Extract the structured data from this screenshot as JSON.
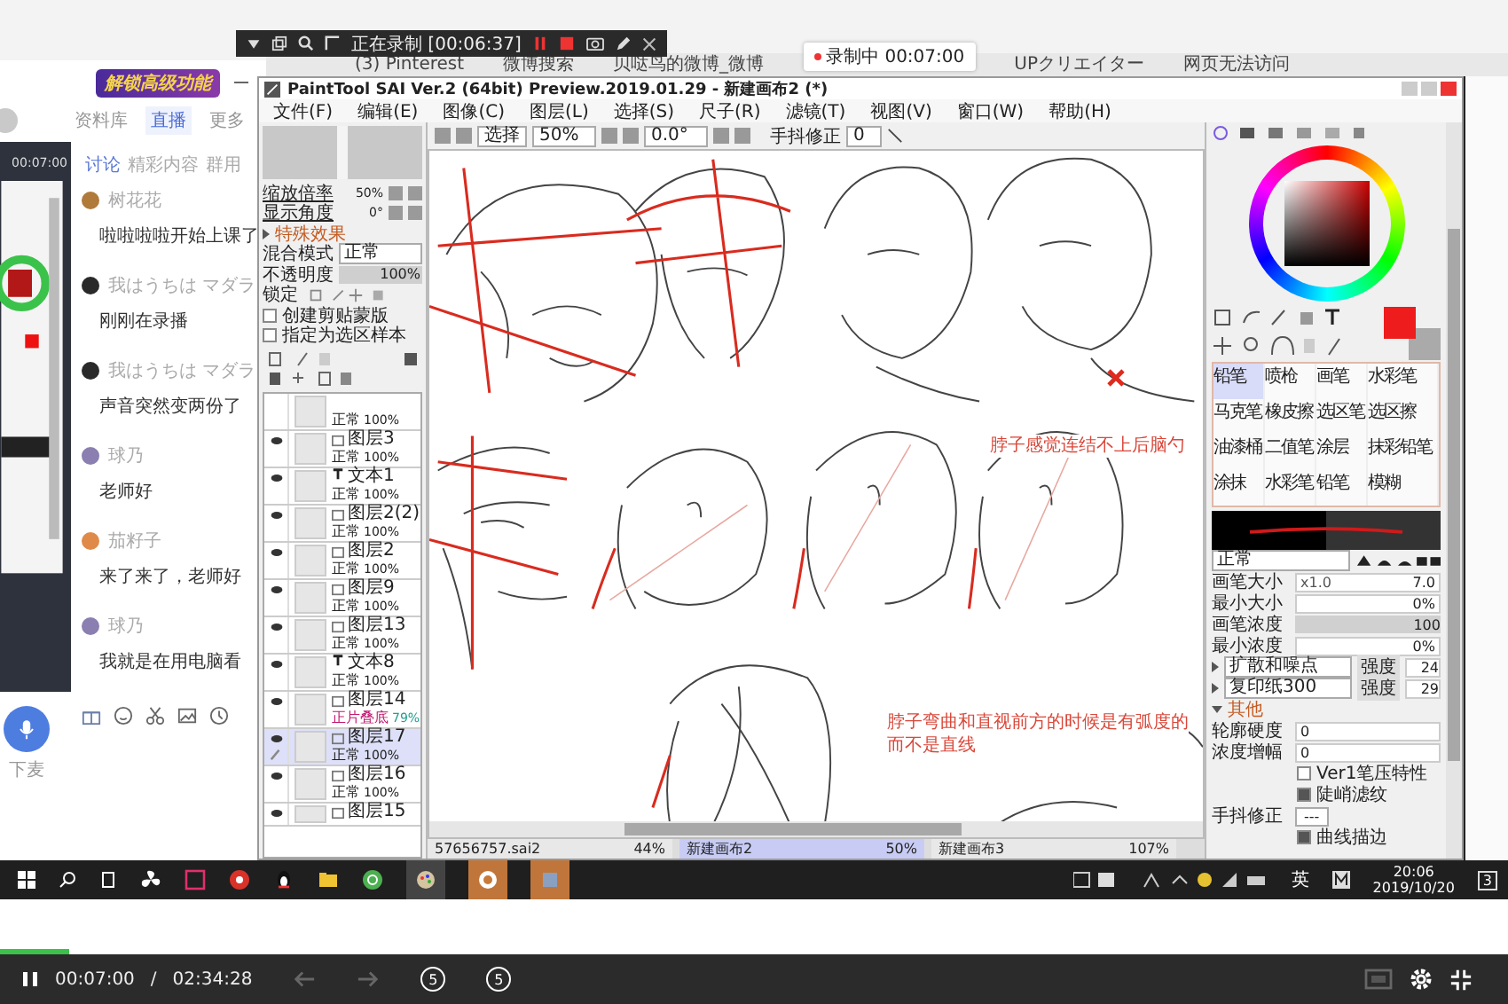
{
  "recorder": {
    "status": "正在录制 [00:06:37]"
  },
  "browser_tabs": [
    {
      "title": "(3) Pinterest"
    },
    {
      "title": "微博搜索"
    },
    {
      "title": "贝哒鸟的微博_微博"
    },
    {
      "title": "UPクリエイター"
    },
    {
      "title": "网页无法访问"
    }
  ],
  "recording_badge": "录制中 00:07:00",
  "classroom": {
    "banner": "解锁高级功能",
    "tabs": [
      {
        "label": "资料库",
        "selected": false
      },
      {
        "label": "直播",
        "selected": true
      },
      {
        "label": "更多",
        "selected": false
      }
    ],
    "video_time": "00:07:00",
    "chat_tabs": [
      {
        "label": "讨论",
        "selected": true
      },
      {
        "label": "精彩内容",
        "selected": false
      },
      {
        "label": "群用",
        "selected": false
      }
    ],
    "messages": [
      {
        "user": "树花花",
        "text": "啦啦啦啦开始上课了",
        "color": "#b07a3a"
      },
      {
        "user": "我はうちは マダラ",
        "text": "刚刚在录播",
        "color": "#2a2a2a"
      },
      {
        "user": "我はうちは マダラ",
        "text": "声音突然变两份了",
        "color": "#2a2a2a"
      },
      {
        "user": "球乃",
        "text": "老师好",
        "color": "#8a7fb0"
      },
      {
        "user": "茄籽子",
        "text": "来了来了，老师好",
        "color": "#e08a4a"
      },
      {
        "user": "球乃",
        "text": "我就是在用电脑看",
        "color": "#8a7fb0"
      }
    ],
    "mic_label": "下麦"
  },
  "sai": {
    "title": "PaintTool SAI Ver.2 (64bit) Preview.2019.01.29 - 新建画布2 (*)",
    "menu": [
      "文件(F)",
      "编辑(E)",
      "图像(C)",
      "图层(L)",
      "选择(S)",
      "尺子(R)",
      "滤镜(T)",
      "视图(V)",
      "窗口(W)",
      "帮助(H)"
    ],
    "toolbar": {
      "select": "选择",
      "zoom": "50%",
      "angle": "0.0°",
      "stabilizer_label": "手抖修正",
      "stabilizer": "0"
    },
    "navigator": {
      "zoom_label": "缩放倍率",
      "zoom": "50%",
      "angle_label": "显示角度",
      "angle": "0°"
    },
    "effects_label": "特殊效果",
    "blend": {
      "label": "混合模式",
      "value": "正常"
    },
    "opacity": {
      "label": "不透明度",
      "value": "100%",
      "level": 1
    },
    "lock_label": "锁定",
    "options": [
      {
        "label": "创建剪贴蒙版",
        "checked": false
      },
      {
        "label": "指定为选区样本",
        "checked": false
      }
    ],
    "layers": [
      {
        "kind": "raster",
        "mode": "正常",
        "opacity": "100%",
        "visible": false,
        "selected": false
      },
      {
        "kind": "raster",
        "name": "图层3",
        "mode": "正常",
        "opacity": "100%",
        "visible": true,
        "selected": false
      },
      {
        "kind": "text",
        "name": "文本1",
        "mode": "正常",
        "opacity": "100%",
        "visible": true,
        "selected": false
      },
      {
        "kind": "raster",
        "name": "图层2(2)",
        "mode": "正常",
        "opacity": "100%",
        "visible": true,
        "selected": false
      },
      {
        "kind": "raster",
        "name": "图层2",
        "mode": "正常",
        "opacity": "100%",
        "visible": true,
        "selected": false
      },
      {
        "kind": "raster",
        "name": "图层9",
        "mode": "正常",
        "opacity": "100%",
        "visible": true,
        "selected": false
      },
      {
        "kind": "raster",
        "name": "图层13",
        "mode": "正常",
        "opacity": "100%",
        "visible": true,
        "selected": false
      },
      {
        "kind": "text",
        "name": "文本8",
        "mode": "正常",
        "opacity": "100%",
        "visible": true,
        "selected": false
      },
      {
        "kind": "raster",
        "name": "图层14",
        "mode": "正片叠底",
        "opacity": "79%",
        "visible": true,
        "selected": false,
        "clipped": true
      },
      {
        "kind": "raster",
        "name": "图层17",
        "mode": "正常",
        "opacity": "100%",
        "visible": true,
        "selected": true
      },
      {
        "kind": "raster",
        "name": "图层16",
        "mode": "正常",
        "opacity": "100%",
        "visible": true,
        "selected": false
      },
      {
        "kind": "raster",
        "name": "图层15",
        "visible": true,
        "selected": false
      }
    ],
    "notes": [
      {
        "lines": [
          "脖子感觉连结不上后脑勺"
        ]
      },
      {
        "lines": [
          "脖子弯曲和直视前方的时候是有弧度的",
          "而不是直线"
        ]
      }
    ],
    "documents": [
      {
        "name": "57656757.sai2",
        "zoom": "44%",
        "selected": false
      },
      {
        "name": "新建画布2",
        "zoom": "50%",
        "selected": true
      },
      {
        "name": "新建画布3",
        "zoom": "107%",
        "selected": false
      }
    ],
    "primary_swatch": {
      "color": "#ee1c1c"
    },
    "brushes": [
      {
        "name": "铅笔",
        "selected": true
      },
      {
        "name": "喷枪",
        "selected": false
      },
      {
        "name": "画笔",
        "selected": false
      },
      {
        "name": "水彩笔",
        "selected": false
      },
      {
        "name": "马克笔",
        "selected": false
      },
      {
        "name": "橡皮擦",
        "selected": false
      },
      {
        "name": "选区笔",
        "selected": false
      },
      {
        "name": "选区擦",
        "selected": false
      },
      {
        "name": "油漆桶",
        "selected": false
      },
      {
        "name": "二值笔",
        "selected": false
      },
      {
        "name": "涂层",
        "selected": false
      },
      {
        "name": "抹彩铅笔",
        "selected": false
      },
      {
        "name": "涂抹",
        "selected": false
      },
      {
        "name": "水彩笔",
        "selected": false
      },
      {
        "name": "铅笔",
        "selected": false
      },
      {
        "name": "模糊",
        "selected": false
      }
    ],
    "brush_settings": {
      "mode": "正常",
      "rows": [
        {
          "kind": "value",
          "label": "画笔大小",
          "multiplier": "x1.0",
          "value": "7.0"
        },
        {
          "kind": "value",
          "label": "最小大小",
          "value": "0%"
        },
        {
          "kind": "bar",
          "label": "画笔浓度",
          "value": "100",
          "level": 1
        },
        {
          "kind": "value",
          "label": "最小浓度",
          "value": "0%"
        }
      ],
      "textures": [
        {
          "name": "扩散和噪点",
          "strength_label": "强度",
          "strength": "24"
        },
        {
          "name": "复印纸300",
          "strength_label": "强度",
          "strength": "29"
        }
      ],
      "other_label": "其他",
      "other_rows": [
        {
          "label": "轮廓硬度",
          "value": "0"
        },
        {
          "label": "浓度增幅",
          "value": "0"
        }
      ],
      "checks": [
        {
          "label": "Ver1笔压特性",
          "checked": false
        },
        {
          "label": "陡峭滤纹",
          "checked": true
        }
      ],
      "stabilizer": {
        "label": "手抖修正",
        "value": "---"
      },
      "curve": {
        "label": "曲线描边",
        "checked": true
      }
    }
  },
  "taskbar": {
    "ime": "英",
    "time": "20:06",
    "date": "2019/10/20",
    "notifications": "3"
  },
  "player": {
    "position": "00:07:00",
    "separator": "/",
    "duration": "02:34:28",
    "level": 0.046,
    "skip_back": "5",
    "skip_forward": "5"
  }
}
